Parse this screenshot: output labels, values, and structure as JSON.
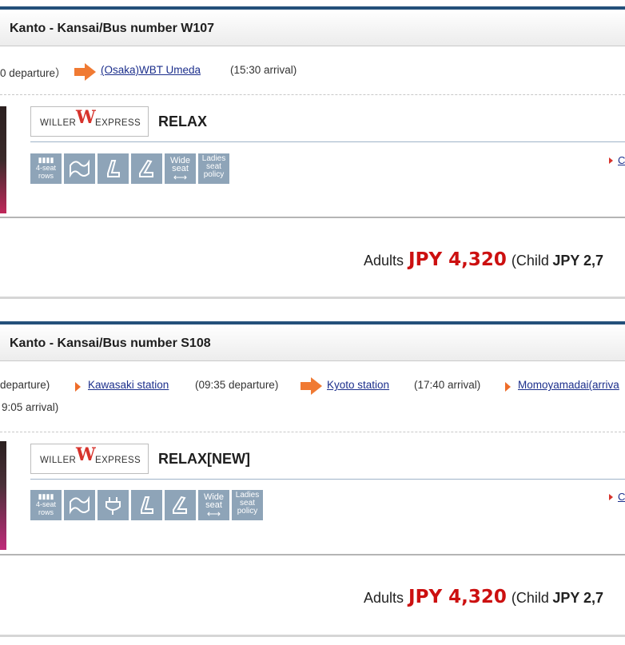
{
  "colors": {
    "header_accent": "#24507a",
    "price_red": "#cc1010",
    "arrow_orange": "#f07a33",
    "icon_gray": "#8ea4b8"
  },
  "cards": [
    {
      "title": "Kanto - Kansai/Bus number W107",
      "route": {
        "left_time": "0 departure）",
        "stop": "(Osaka)WBT Umeda",
        "stop_time": "(15:30 arrival)"
      },
      "logo": {
        "willer": "WILLER",
        "w": "W",
        "express": "EXPRESS"
      },
      "seat_type": "RELAX",
      "icons": [
        "4-seat rows",
        "blanket",
        "reclining seat",
        "reclining seat",
        "Wide seat",
        "Ladies seat policy"
      ],
      "detail_link": "C",
      "price": {
        "adults_label": "Adults",
        "amount": "JPY 4,320",
        "child_label": "(Child",
        "child_amount": "JPY 2,7"
      }
    },
    {
      "title": "Kanto - Kansai/Bus number S108",
      "route": {
        "left_time": " departure)",
        "stop1": "Kawasaki station",
        "stop1_time": "(09:35 departure)",
        "stop2": "Kyoto station",
        "stop2_time": "(17:40 arrival)",
        "stop3": "Momoyamadai(arriva",
        "line2": "9:05 arrival)"
      },
      "logo": {
        "willer": "WILLER",
        "w": "W",
        "express": "EXPRESS"
      },
      "seat_type": "RELAX[NEW]",
      "icons": [
        "4-seat rows",
        "blanket",
        "power outlet",
        "reclining seat",
        "reclining seat",
        "Wide seat",
        "Ladies seat policy"
      ],
      "detail_link": "C",
      "price": {
        "adults_label": "Adults",
        "amount": "JPY 4,320",
        "child_label": "(Child",
        "child_amount": "JPY 2,7"
      }
    }
  ]
}
